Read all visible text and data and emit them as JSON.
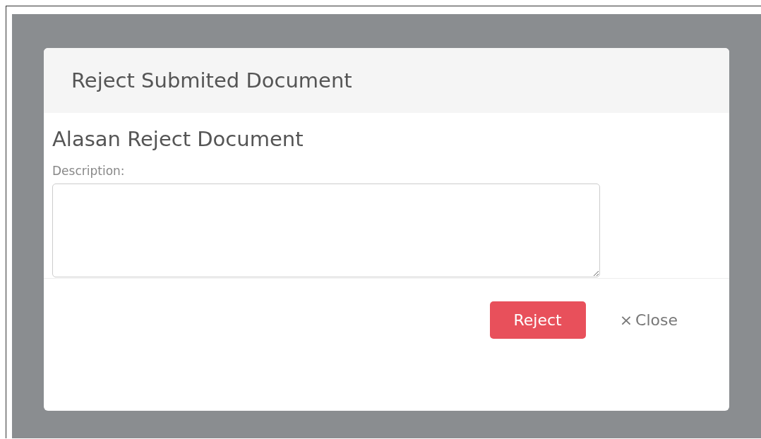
{
  "modal": {
    "title": "Reject Submited Document",
    "heading": "Alasan Reject Document",
    "field": {
      "label": "Description:"
    },
    "buttons": [
      {
        "kind": "danger",
        "label": "Reject"
      },
      {
        "kind": "link",
        "icon": "×",
        "label": "Close"
      }
    ]
  }
}
